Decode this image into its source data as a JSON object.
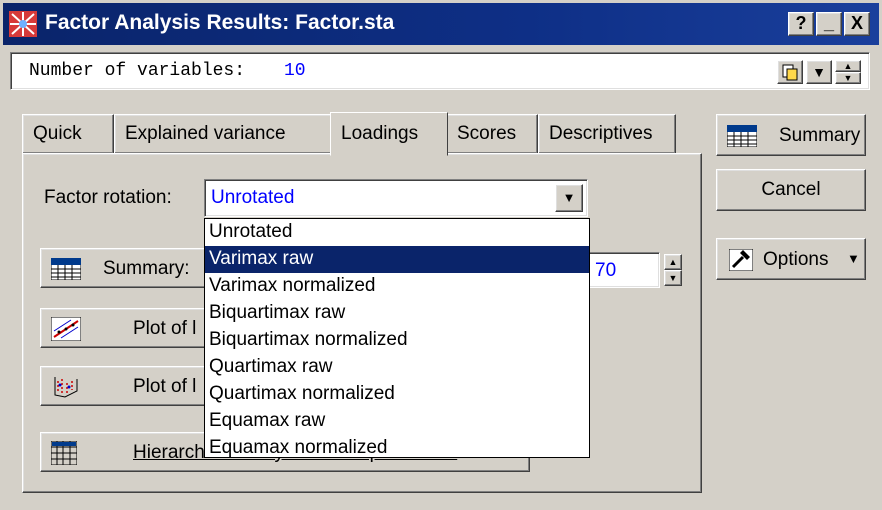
{
  "window": {
    "title": "Factor Analysis Results: Factor.sta"
  },
  "titlebar_buttons": {
    "help": "?",
    "minimize": "_",
    "close": "X"
  },
  "info_bar": {
    "label": "Number of variables:",
    "value": "10"
  },
  "tabs": [
    {
      "label": "Quick"
    },
    {
      "label": "Explained variance"
    },
    {
      "label": "Loadings"
    },
    {
      "label": "Scores"
    },
    {
      "label": "Descriptives"
    }
  ],
  "loadings": {
    "rotation_label": "Factor rotation:",
    "rotation_value": "Unrotated",
    "summary_button": "Summary:",
    "plot_button_1": "Plot of l",
    "plot_button_2": "Plot of l",
    "hierarchical_button": "Hierarchical analysis of oblique factors",
    "spinner_value": "70"
  },
  "dropdown_options": [
    "Unrotated",
    "Varimax raw",
    "Varimax normalized",
    "Biquartimax raw",
    "Biquartimax normalized",
    "Quartimax raw",
    "Quartimax normalized",
    "Equamax raw",
    "Equamax normalized"
  ],
  "selected_option_index": 1,
  "side_buttons": {
    "summary": "Summary",
    "cancel": "Cancel",
    "options": "Options"
  },
  "colors": {
    "title_bar": "#0a246a",
    "selection": "#0a246a",
    "value_text": "#0000ff"
  }
}
